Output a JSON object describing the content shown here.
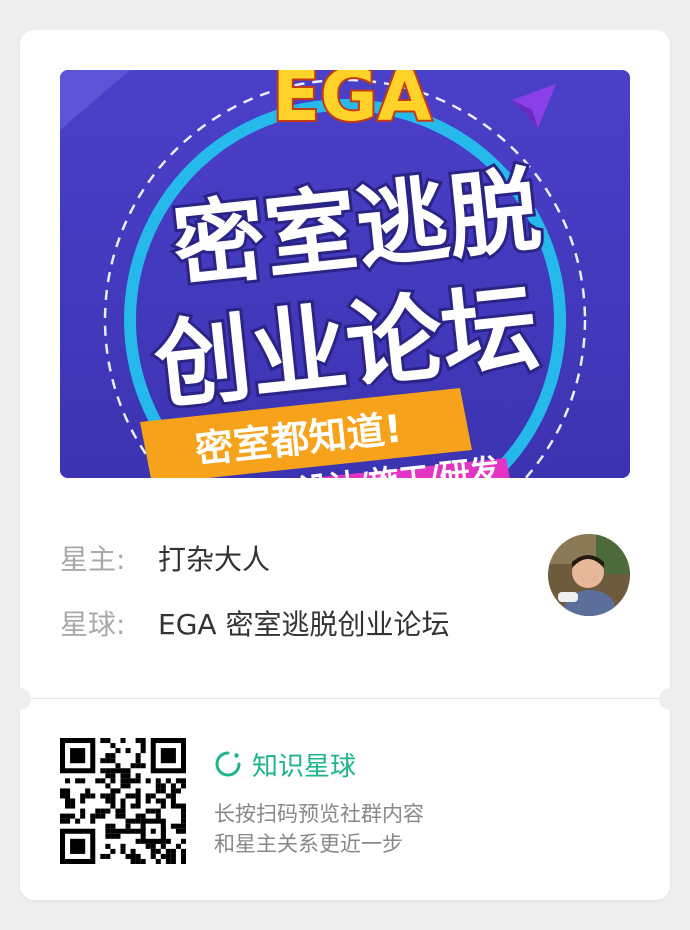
{
  "banner": {
    "logo_text": "EGA",
    "title_line1": "密室逃脱",
    "title_line2": "创业论坛",
    "ribbon_text": "密室都知道!",
    "bottom_text": "设计/施工/研发"
  },
  "owner": {
    "label": "星主:",
    "name": "打杂大人"
  },
  "planet": {
    "label": "星球:",
    "name": "EGA 密室逃脱创业论坛"
  },
  "footer": {
    "brand_name": "知识星球",
    "line1": "长按扫码预览社群内容",
    "line2": "和星主关系更近一步"
  },
  "colors": {
    "brand_green": "#1fb48b",
    "banner_purple": "#4a3fc6",
    "ribbon_orange": "#f6a21a",
    "logo_yellow": "#ffd22a"
  },
  "icons": {
    "brand": "planet-ring-icon",
    "qr": "qr-code"
  }
}
